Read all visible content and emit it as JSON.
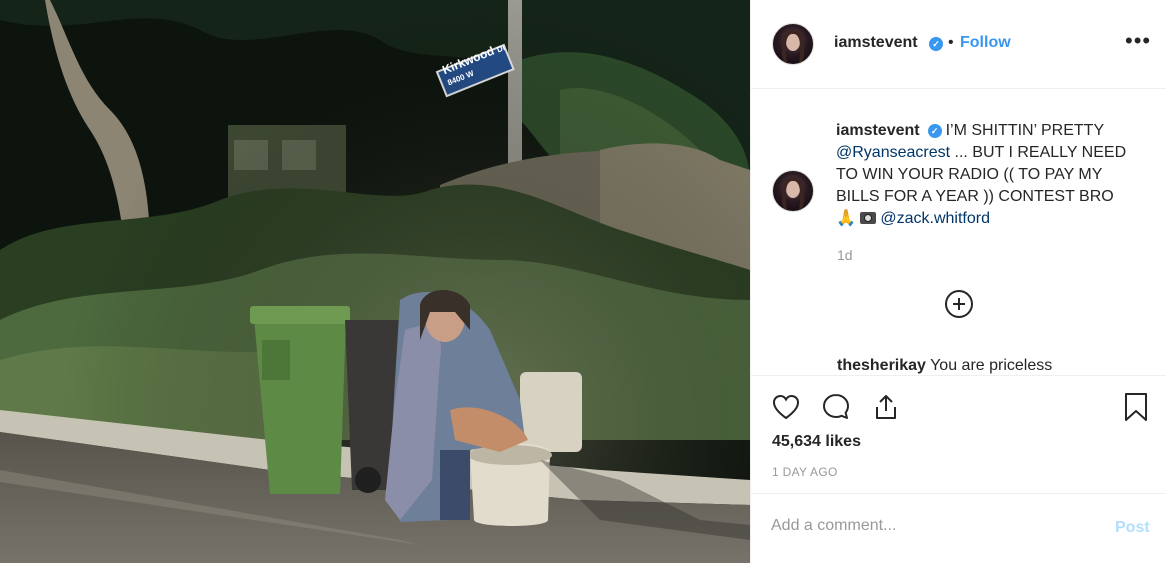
{
  "post": {
    "photo_alt": "Street sign Kirkwood Dr 8400 W",
    "street_sign": {
      "line1": "Kirkwood",
      "suffix": "Dr",
      "line2": "8400 W"
    }
  },
  "header": {
    "username": "iamstevent",
    "verified_icon": "verified-badge-icon",
    "separator": "•",
    "follow_label": "Follow",
    "more_icon": "more-options-icon",
    "more_glyph": "•••"
  },
  "caption": {
    "username": "iamstevent",
    "text_1": "I’M SHITTIN’ PRETTY",
    "mention_1": "@Ryanseacrest",
    "text_2": "... BUT I REALLY NEED TO WIN YOUR RADIO (( TO PAY MY BILLS FOR A YEAR )) CONTEST BRO 🙏",
    "mention_2": "@zack.whitford",
    "time_ago": "1d"
  },
  "next_comment": {
    "username": "thesherikay",
    "text": "You are priceless"
  },
  "actions": {
    "like_icon": "heart-icon",
    "comment_icon": "comment-icon",
    "share_icon": "share-icon",
    "save_icon": "bookmark-icon",
    "likes_text": "45,634 likes",
    "date_text": "1 DAY AGO"
  },
  "comment_box": {
    "placeholder": "Add a comment...",
    "post_label": "Post"
  },
  "colors": {
    "link_blue": "#3897f0",
    "mention_blue": "#003569",
    "post_disabled": "#b2dffc",
    "muted": "#999999"
  }
}
